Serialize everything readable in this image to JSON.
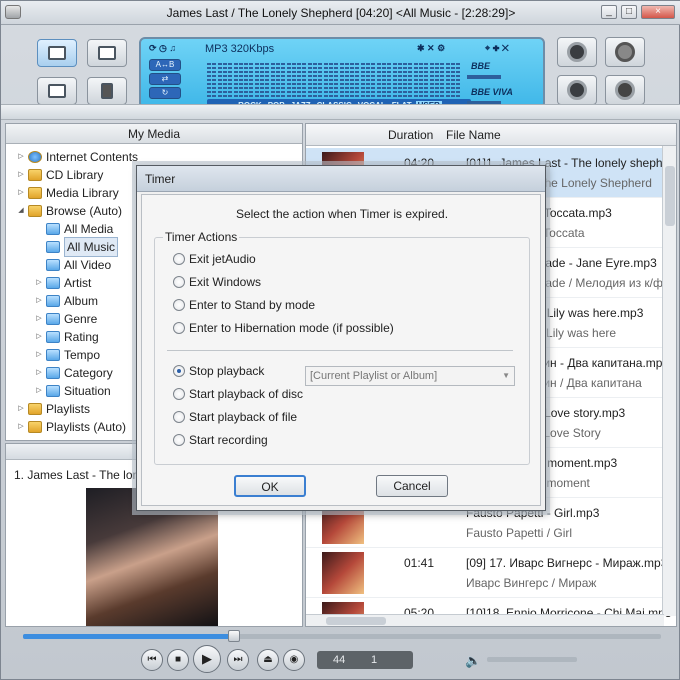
{
  "window": {
    "title": "James Last / The Lonely Shepherd    [04:20]    <All Music - [2:28:29]>",
    "controls": [
      "_",
      "□",
      "×"
    ]
  },
  "display": {
    "format": "MP3 320Kbps",
    "ab_label": "A↔B",
    "presets": [
      "ROCK",
      "POP",
      "JAZZ",
      "CLASSIC",
      "VOCAL",
      "FLAT",
      "USER"
    ],
    "selected_preset": "USER",
    "bbe1": "BBE",
    "bbe2": "BBE VIVA"
  },
  "sidebar": {
    "header": "My Media",
    "items": [
      {
        "label": "Internet Contents",
        "indent": 0,
        "icon": "globe-icon",
        "twisty": "▷"
      },
      {
        "label": "CD Library",
        "indent": 0,
        "icon": "cd-icon",
        "twisty": "▷"
      },
      {
        "label": "Media Library",
        "indent": 0,
        "icon": "library-icon",
        "twisty": "▷"
      },
      {
        "label": "Browse (Auto)",
        "indent": 0,
        "icon": "folder-icon",
        "twisty": "◢"
      },
      {
        "label": "All Media",
        "indent": 1,
        "icon": "media-icon",
        "twisty": ""
      },
      {
        "label": "All Music",
        "indent": 1,
        "icon": "music-note-icon",
        "twisty": "",
        "selected": true
      },
      {
        "label": "All Video",
        "indent": 1,
        "icon": "video-icon",
        "twisty": ""
      },
      {
        "label": "Artist",
        "indent": 1,
        "icon": "artist-icon",
        "twisty": "▷"
      },
      {
        "label": "Album",
        "indent": 1,
        "icon": "album-icon",
        "twisty": "▷"
      },
      {
        "label": "Genre",
        "indent": 1,
        "icon": "genre-icon",
        "twisty": "▷"
      },
      {
        "label": "Rating",
        "indent": 1,
        "icon": "rating-icon",
        "twisty": "▷"
      },
      {
        "label": "Tempo",
        "indent": 1,
        "icon": "tempo-icon",
        "twisty": "▷"
      },
      {
        "label": "Category",
        "indent": 1,
        "icon": "category-icon",
        "twisty": "▷"
      },
      {
        "label": "Situation",
        "indent": 1,
        "icon": "situation-icon",
        "twisty": "▷"
      },
      {
        "label": "Playlists",
        "indent": 0,
        "icon": "playlist-icon",
        "twisty": "▷"
      },
      {
        "label": "Playlists (Auto)",
        "indent": 0,
        "icon": "playlist-auto-icon",
        "twisty": "▷"
      }
    ]
  },
  "nowplaying": {
    "line": "1. James Last - The lonely shepherd"
  },
  "list": {
    "columns": [
      "Duration",
      "File Name"
    ],
    "rows": [
      {
        "duration": "04:20",
        "file": "[01]1. James Last - The lonely shepherd",
        "sub": "James Last / The Lonely Shepherd",
        "selected": true
      },
      {
        "duration": "",
        "file": "Paul Mauriat - Toccata.mp3",
        "sub": "Paul Mauriat / Toccata",
        "selected": false
      },
      {
        "duration": "",
        "file": "Moscow Serenade - Jane Eyre.mp3",
        "sub": "Moscow Serenade / Мелодия из к/ф Jane Eyre",
        "selected": false
      },
      {
        "duration": "",
        "file": "Candy Dulfer - Lily was here.mp3",
        "sub": "Candy Dulfer / Lily was here",
        "selected": false
      },
      {
        "duration": "",
        "file": "Андрей Птичкин - Два капитана.mp3",
        "sub": "Андрей Птичкин / Два капитана",
        "selected": false
      },
      {
        "duration": "",
        "file": "Paul Mauriat - Love story.mp3",
        "sub": "Paul Mauriat / Love Story",
        "selected": false
      },
      {
        "duration": "",
        "file": "Kenny G - The moment.mp3",
        "sub": "Kenny G / The moment",
        "selected": false
      },
      {
        "duration": "",
        "file": "Fausto Papetti - Girl.mp3",
        "sub": "Fausto Papetti / Girl",
        "selected": false
      },
      {
        "duration": "01:41",
        "file": "[09] 17. Иварс Вигнерс - Мираж.mp3",
        "sub": "Иварс Вингерс / Мираж",
        "selected": false
      },
      {
        "duration": "05:20",
        "file": "[10]18. Ennio Morricone - Chi Mai.mp3",
        "sub": "",
        "selected": false
      }
    ]
  },
  "player": {
    "progress": 0.33,
    "counter_left": "44",
    "counter_right": "1",
    "volume": 0.05
  },
  "dialog": {
    "title": "Timer",
    "message": "Select the action when Timer is expired.",
    "group_label": "Timer Actions",
    "options": [
      {
        "label": "Exit jetAudio",
        "checked": false
      },
      {
        "label": "Exit Windows",
        "checked": false
      },
      {
        "label": "Enter to Stand by mode",
        "checked": false
      },
      {
        "label": "Enter to Hibernation mode (if possible)",
        "checked": false
      },
      {
        "label": "Stop playback",
        "checked": true
      },
      {
        "label": "Start playback of disc",
        "checked": false
      },
      {
        "label": "Start playback of file",
        "checked": false
      },
      {
        "label": "Start recording",
        "checked": false
      }
    ],
    "file_select_placeholder": "[Current Playlist or Album]",
    "ok_label": "OK",
    "cancel_label": "Cancel"
  }
}
